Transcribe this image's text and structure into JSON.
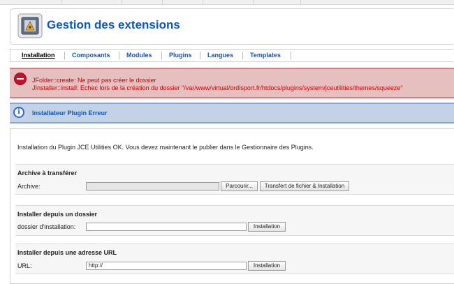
{
  "header": {
    "title": "Gestion des extensions",
    "icon": "extension-manager-icon"
  },
  "tabs": [
    {
      "label": "Installation",
      "active": true
    },
    {
      "label": "Composants"
    },
    {
      "label": "Modules"
    },
    {
      "label": "Plugins"
    },
    {
      "label": "Langues"
    },
    {
      "label": "Templates"
    }
  ],
  "error": {
    "icon": "error-icon",
    "lines": [
      "JFolder::create: Ne peut pas créer le dossier",
      "JInstaller::install: Echec lors de la création du dossier \"/var/www/virtual/ordisport.fr/htdocs/plugins/system/jceutilities/themes/squeeze\""
    ]
  },
  "notice": {
    "icon": "info-icon",
    "message": "Installateur Plugin Erreur"
  },
  "install_message": "Installation du Plugin JCE Utilities OK. Vous devez maintenant le publier dans le Gestionnaire des Plugins.",
  "upload": {
    "heading": "Archive à transférer",
    "label": "Archive:",
    "browse_label": "Parcourir...",
    "submit_label": "Transfert de fichier & Installation"
  },
  "directory": {
    "heading": "Installer depuis un dossier",
    "label": "dossier d'installation:",
    "value": "",
    "submit_label": "Installation"
  },
  "url": {
    "heading": "Installer depuis une adresse URL",
    "label": "URL:",
    "value": "http://",
    "submit_label": "Installation"
  },
  "colors": {
    "title": "#0b55c4",
    "error_text": "#cc0000",
    "error_bg": "#e6c0c0",
    "notice_bg": "#c3d2e5"
  }
}
